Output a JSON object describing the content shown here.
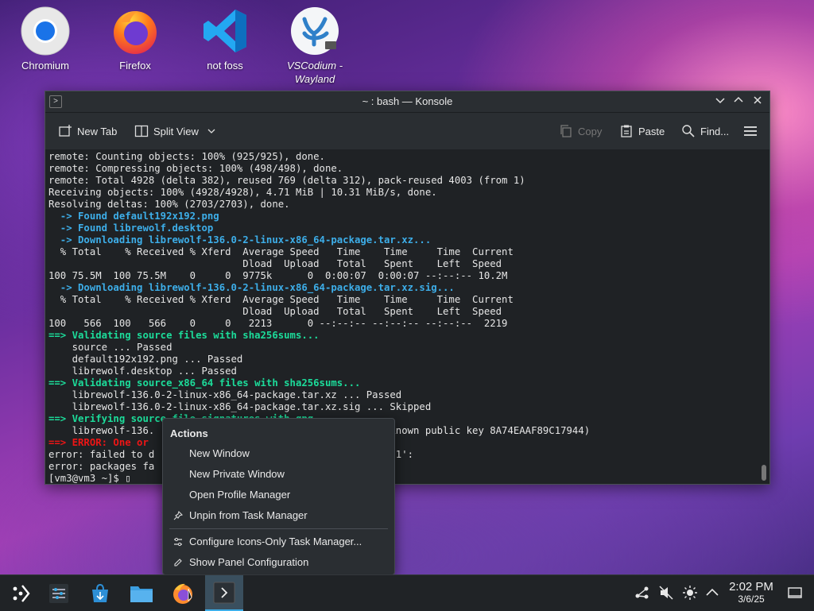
{
  "desktop_icons": [
    {
      "label": "Chromium",
      "icon": "chromium-icon"
    },
    {
      "label": "Firefox",
      "icon": "firefox-icon"
    },
    {
      "label": "not foss",
      "icon": "vscode-icon"
    },
    {
      "label": "VSCodium -",
      "label2": "Wayland",
      "icon": "vscodium-icon"
    }
  ],
  "window": {
    "title": "~ : bash — Konsole",
    "toolbar": {
      "new_tab": "New Tab",
      "split_view": "Split View",
      "copy": "Copy",
      "paste": "Paste",
      "find": "Find..."
    }
  },
  "terminal": {
    "lines": [
      {
        "t": "remote: Counting objects: 100% (925/925), done.",
        "c": ""
      },
      {
        "t": "remote: Compressing objects: 100% (498/498), done.",
        "c": ""
      },
      {
        "t": "remote: Total 4928 (delta 382), reused 769 (delta 312), pack-reused 4003 (from 1)",
        "c": ""
      },
      {
        "t": "Receiving objects: 100% (4928/4928), 4.71 MiB | 10.31 MiB/s, done.",
        "c": ""
      },
      {
        "t": "Resolving deltas: 100% (2703/2703), done.",
        "c": ""
      },
      {
        "t": "  -> Found default192x192.png",
        "c": "blue"
      },
      {
        "t": "  -> Found librewolf.desktop",
        "c": "blue"
      },
      {
        "t": "  -> Downloading librewolf-136.0-2-linux-x86_64-package.tar.xz...",
        "c": "blue"
      },
      {
        "t": "  % Total    % Received % Xferd  Average Speed   Time    Time     Time  Current",
        "c": ""
      },
      {
        "t": "                                 Dload  Upload   Total   Spent    Left  Speed",
        "c": ""
      },
      {
        "t": "100 75.5M  100 75.5M    0     0  9775k      0  0:00:07  0:00:07 --:--:-- 10.2M",
        "c": ""
      },
      {
        "t": "  -> Downloading librewolf-136.0-2-linux-x86_64-package.tar.xz.sig...",
        "c": "blue"
      },
      {
        "t": "  % Total    % Received % Xferd  Average Speed   Time    Time     Time  Current",
        "c": ""
      },
      {
        "t": "                                 Dload  Upload   Total   Spent    Left  Speed",
        "c": ""
      },
      {
        "t": "100   566  100   566    0     0   2213      0 --:--:-- --:--:-- --:--:--  2219",
        "c": ""
      },
      {
        "t": "==> Validating source files with sha256sums...",
        "c": "green"
      },
      {
        "t": "    source ... Passed",
        "c": ""
      },
      {
        "t": "    default192x192.png ... Passed",
        "c": ""
      },
      {
        "t": "    librewolf.desktop ... Passed",
        "c": ""
      },
      {
        "t": "==> Validating source_x86_64 files with sha256sums...",
        "c": "green"
      },
      {
        "t": "    librewolf-136.0-2-linux-x86_64-package.tar.xz ... Passed",
        "c": ""
      },
      {
        "t": "    librewolf-136.0-2-linux-x86_64-package.tar.xz.sig ... Skipped",
        "c": ""
      },
      {
        "t": "==> Verifying source file signatures with gpg...",
        "c": "green"
      },
      {
        "t": "    librewolf-136.                              FAILED (unknown public key 8A74EAAF89C17944)",
        "c": ""
      },
      {
        "t": "==> ERROR: One or                               ified!",
        "c": "red"
      },
      {
        "t": "error: failed to d                              :136.0.0_2-1':",
        "c": ""
      },
      {
        "t": "error: packages fa                              .0_2-1",
        "c": ""
      },
      {
        "t": "[vm3@vm3 ~]$ ▯",
        "c": ""
      }
    ]
  },
  "context_menu": {
    "header": "Actions",
    "items": [
      {
        "label": "New Window",
        "icon": ""
      },
      {
        "label": "New Private Window",
        "icon": ""
      },
      {
        "label": "Open Profile Manager",
        "icon": ""
      },
      {
        "label": "Unpin from Task Manager",
        "icon": "pin-icon"
      },
      {
        "label": "Configure Icons-Only Task Manager...",
        "icon": "configure-icon"
      },
      {
        "label": "Show Panel Configuration",
        "icon": "edit-icon"
      }
    ]
  },
  "taskbar": {
    "clock_time": "2:02 PM",
    "clock_date": "3/6/25"
  }
}
